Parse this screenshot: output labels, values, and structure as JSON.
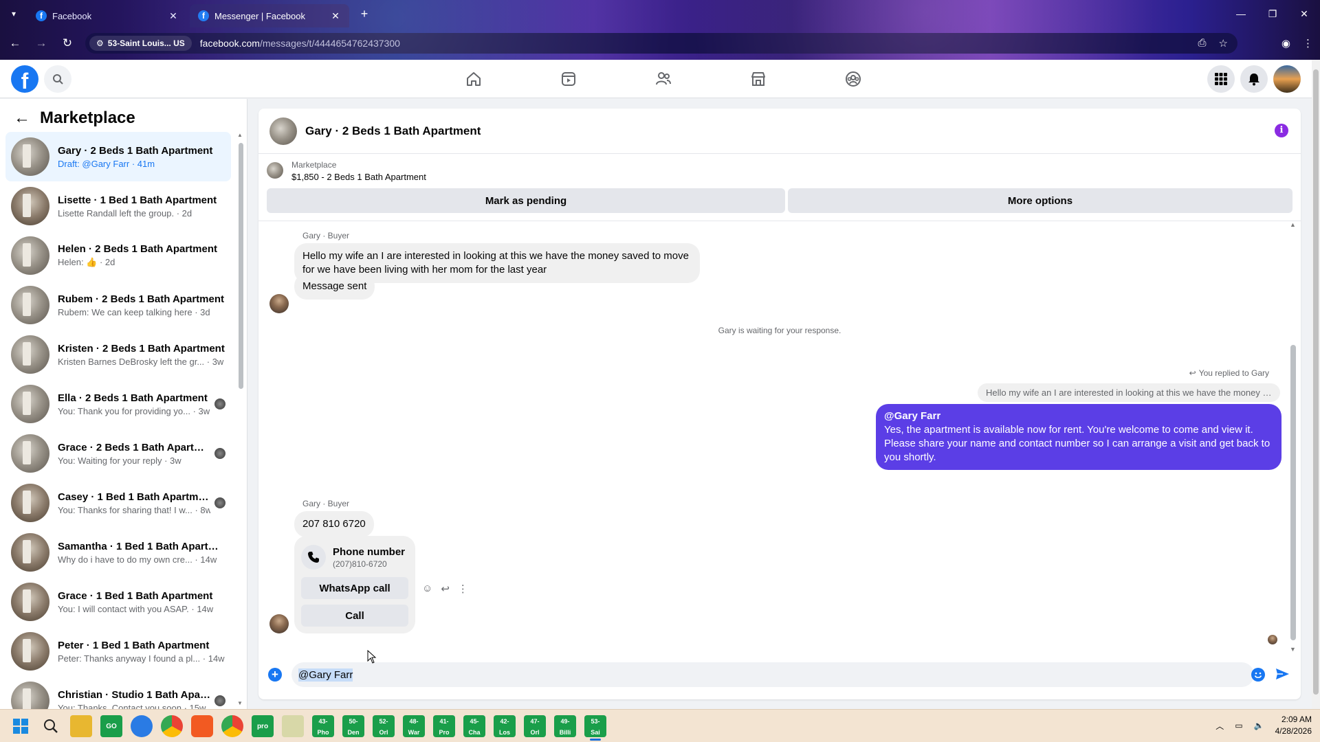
{
  "browser": {
    "tabs": [
      {
        "title": "Facebook",
        "active": false
      },
      {
        "title": "Messenger | Facebook",
        "active": true
      }
    ],
    "site_chip": "53-Saint Louis... US",
    "url_domain": "facebook.com",
    "url_path": "/messages/t/4444654762437300"
  },
  "sidebar": {
    "title": "Marketplace",
    "conversations": [
      {
        "name": "Gary · 2 Beds 1 Bath Apartment",
        "preview": "Draft: @Gary Farr · 41m",
        "active": true
      },
      {
        "name": "Lisette · 1 Bed 1 Bath Apartment",
        "preview": "Lisette Randall left the group. · 2d"
      },
      {
        "name": "Helen · 2 Beds 1 Bath Apartment",
        "preview": "Helen: 👍 · 2d"
      },
      {
        "name": "Rubem · 2 Beds 1 Bath Apartment",
        "preview": "Rubem: We can keep talking here · 3d"
      },
      {
        "name": "Kristen · 2 Beds 1 Bath Apartment",
        "preview": "Kristen Barnes DeBrosky left the gr... · 3w"
      },
      {
        "name": "Ella · 2 Beds 1 Bath Apartment",
        "preview": "You: Thank you for providing yo... · 3w"
      },
      {
        "name": "Grace · 2 Beds 1 Bath Apartme...",
        "preview": "You: Waiting for your reply · 3w"
      },
      {
        "name": "Casey · 1 Bed 1 Bath Apartment",
        "preview": "You: Thanks for sharing that! I w... · 8w"
      },
      {
        "name": "Samantha · 1 Bed 1 Bath Apartm...",
        "preview": "Why do i have to do my own cre... · 14w"
      },
      {
        "name": "Grace · 1 Bed 1 Bath Apartment",
        "preview": "You: I will contact with you ASAP. · 14w"
      },
      {
        "name": "Peter · 1 Bed 1 Bath Apartment",
        "preview": "Peter: Thanks anyway I found a pl... · 14w"
      },
      {
        "name": "Christian · Studio 1 Bath Apart...",
        "preview": "You: Thanks. Contact you soon · 15w"
      }
    ]
  },
  "chat": {
    "header_title": "Gary · 2 Beds 1 Bath Apartment",
    "listing_category": "Marketplace",
    "listing_price": "$1,850 - 2 Beds 1 Bath Apartment",
    "mark_pending": "Mark as pending",
    "more_options": "More options",
    "sender_label": "Gary · Buyer",
    "msg1": "Hello my wife an I are interested in looking at this we have the money saved to move for we have been living with her mom for the last year",
    "msg2": "Message sent",
    "waiting_note": "Gary is waiting for your response.",
    "replied_note": "You replied to Gary",
    "quoted_text": "Hello my wife an I are interested in looking at this we have the money s...",
    "reply_mention": "@Gary Farr",
    "reply_body": "Yes, the apartment is available now for rent. You're welcome to come and view it. Please share your name and contact number so I can arrange a visit and get back to you shortly.",
    "sender_label2": "Gary · Buyer",
    "phone_msg": "207 810 6720",
    "phone_card_title": "Phone number",
    "phone_card_number": "(207)810-6720",
    "whatsapp_call": "WhatsApp call",
    "call": "Call",
    "composer_value": "@Gary Farr"
  },
  "taskbar": {
    "apps": [
      {
        "top": "43-",
        "sub": "Pho"
      },
      {
        "top": "50-",
        "sub": "Den"
      },
      {
        "top": "52-",
        "sub": "Orl"
      },
      {
        "top": "48-",
        "sub": "War"
      },
      {
        "top": "41-",
        "sub": "Pro"
      },
      {
        "top": "45-",
        "sub": "Cha"
      },
      {
        "top": "42-",
        "sub": "Los"
      },
      {
        "top": "47-",
        "sub": "Orl"
      },
      {
        "top": "49-",
        "sub": "Billi"
      },
      {
        "top": "53-",
        "sub": "Sai"
      }
    ],
    "time": "2:09 AM",
    "date": "4/28/2026"
  }
}
